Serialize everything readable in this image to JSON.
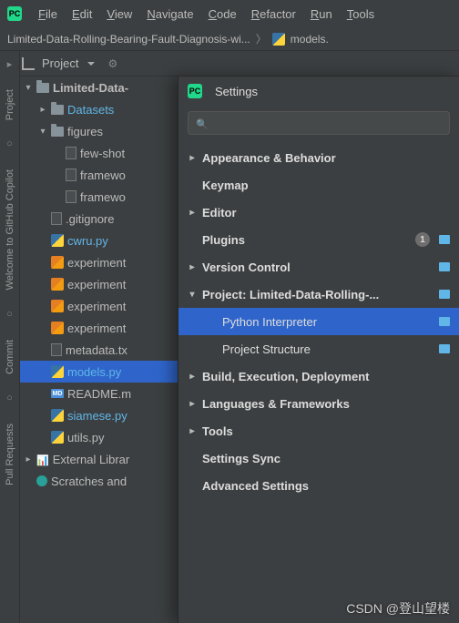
{
  "menu": [
    "File",
    "Edit",
    "View",
    "Navigate",
    "Code",
    "Refactor",
    "Run",
    "Tools"
  ],
  "breadcrumb": {
    "project": "Limited-Data-Rolling-Bearing-Fault-Diagnosis-wi...",
    "file": "models."
  },
  "toolbar": {
    "project_label": "Project"
  },
  "sidetabs": [
    "Project",
    "Welcome to GitHub Copilot",
    "Commit",
    "Pull Requests"
  ],
  "tree": [
    {
      "depth": 0,
      "chev": "down",
      "icon": "folder",
      "label": "Limited-Data-",
      "bold": true
    },
    {
      "depth": 1,
      "chev": "right",
      "icon": "folder",
      "label": "Datasets",
      "hl": true
    },
    {
      "depth": 1,
      "chev": "down",
      "icon": "folder",
      "label": "figures"
    },
    {
      "depth": 2,
      "chev": "none",
      "icon": "text",
      "label": "few-shot"
    },
    {
      "depth": 2,
      "chev": "none",
      "icon": "text",
      "label": "framewo"
    },
    {
      "depth": 2,
      "chev": "none",
      "icon": "text",
      "label": "framewo"
    },
    {
      "depth": 1,
      "chev": "none",
      "icon": "text",
      "label": ".gitignore"
    },
    {
      "depth": 1,
      "chev": "none",
      "icon": "py",
      "label": "cwru.py",
      "hl": true
    },
    {
      "depth": 1,
      "chev": "none",
      "icon": "pyo",
      "label": "experiment"
    },
    {
      "depth": 1,
      "chev": "none",
      "icon": "pyo",
      "label": "experiment"
    },
    {
      "depth": 1,
      "chev": "none",
      "icon": "pyo",
      "label": "experiment"
    },
    {
      "depth": 1,
      "chev": "none",
      "icon": "pyo",
      "label": "experiment"
    },
    {
      "depth": 1,
      "chev": "none",
      "icon": "text",
      "label": "metadata.tx"
    },
    {
      "depth": 1,
      "chev": "none",
      "icon": "py",
      "label": "models.py",
      "hl": true,
      "sel": true
    },
    {
      "depth": 1,
      "chev": "none",
      "icon": "md",
      "label": "README.m"
    },
    {
      "depth": 1,
      "chev": "none",
      "icon": "py",
      "label": "siamese.py",
      "hl": true
    },
    {
      "depth": 1,
      "chev": "none",
      "icon": "py",
      "label": "utils.py"
    },
    {
      "depth": 0,
      "chev": "right",
      "icon": "lib",
      "label": "External Librar"
    },
    {
      "depth": 0,
      "chev": "none",
      "icon": "scratch",
      "label": "Scratches and"
    }
  ],
  "settings": {
    "title": "Settings",
    "items": [
      {
        "chev": "right",
        "label": "Appearance & Behavior",
        "bold": true
      },
      {
        "chev": "none",
        "label": "Keymap",
        "bold": true
      },
      {
        "chev": "right",
        "label": "Editor",
        "bold": true
      },
      {
        "chev": "none",
        "label": "Plugins",
        "bold": true,
        "badge": "1",
        "tag": true
      },
      {
        "chev": "right",
        "label": "Version Control",
        "bold": true,
        "tag": true
      },
      {
        "chev": "down",
        "label": "Project: Limited-Data-Rolling-...",
        "bold": true,
        "tag": true
      },
      {
        "chev": "none",
        "label": "Python Interpreter",
        "sub": true,
        "sel": true,
        "tag": true
      },
      {
        "chev": "none",
        "label": "Project Structure",
        "sub": true,
        "tag": true
      },
      {
        "chev": "right",
        "label": "Build, Execution, Deployment",
        "bold": true
      },
      {
        "chev": "right",
        "label": "Languages & Frameworks",
        "bold": true
      },
      {
        "chev": "right",
        "label": "Tools",
        "bold": true
      },
      {
        "chev": "none",
        "label": "Settings Sync",
        "bold": true
      },
      {
        "chev": "none",
        "label": "Advanced Settings",
        "bold": true
      }
    ]
  },
  "watermark": "CSDN @登山望楼"
}
